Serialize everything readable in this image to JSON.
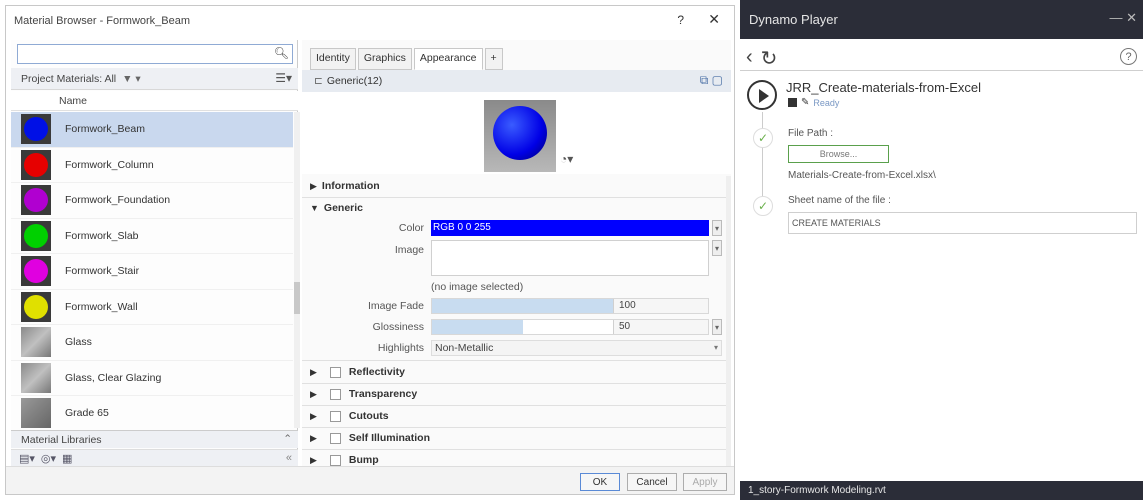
{
  "material_browser": {
    "title": "Material Browser - Formwork_Beam",
    "help": "?",
    "close": "✕",
    "search": {
      "value": "",
      "icon": "search-icon"
    },
    "project_bar": {
      "label": "Project Materials: All",
      "filter": "▼ ▾",
      "view_icon": "list-view-icon"
    },
    "column_header": "Name",
    "materials": [
      {
        "name": "Formwork_Beam",
        "color": "#0010e6",
        "selected": true
      },
      {
        "name": "Formwork_Column",
        "color": "#e60000",
        "selected": false
      },
      {
        "name": "Formwork_Foundation",
        "color": "#b000d0",
        "selected": false
      },
      {
        "name": "Formwork_Slab",
        "color": "#00d000",
        "selected": false
      },
      {
        "name": "Formwork_Stair",
        "color": "#e000e0",
        "selected": false
      },
      {
        "name": "Formwork_Wall",
        "color": "#e0e000",
        "selected": false
      },
      {
        "name": "Glass",
        "color": "",
        "selected": false
      },
      {
        "name": "Glass, Clear Glazing",
        "color": "",
        "selected": false
      },
      {
        "name": "Grade 65",
        "color": "",
        "selected": false
      }
    ],
    "libraries_label": "Material Libraries",
    "tabs": [
      "Identity",
      "Graphics",
      "Appearance",
      "+"
    ],
    "asset_name": "Generic(12)",
    "sections": {
      "information": "Information",
      "generic": "Generic",
      "reflectivity": "Reflectivity",
      "transparency": "Transparency",
      "cutouts": "Cutouts",
      "self_illumination": "Self Illumination",
      "bump": "Bump"
    },
    "props": {
      "color_label": "Color",
      "color_value": "RGB 0 0 255",
      "image_label": "Image",
      "no_image": "(no image selected)",
      "image_fade_label": "Image Fade",
      "image_fade_value": "100",
      "image_fade_level": 1.0,
      "glossiness_label": "Glossiness",
      "glossiness_value": "50",
      "glossiness_level": 0.5,
      "highlights_label": "Highlights",
      "highlights_value": "Non-Metallic"
    },
    "buttons": {
      "ok": "OK",
      "cancel": "Cancel",
      "apply": "Apply"
    }
  },
  "dynamo_player": {
    "title": "Dynamo Player",
    "window_controls": "— ✕",
    "help": "?",
    "script_name": "JRR_Create-materials-from-Excel",
    "status": "Ready",
    "inputs": [
      {
        "label": "File Path :",
        "button": "Browse...",
        "value": "Materials-Create-from-Excel.xlsx\\"
      },
      {
        "label": "Sheet name of the file :",
        "value": "CREATE MATERIALS"
      }
    ],
    "footer": "1_story-Formwork Modeling.rvt"
  }
}
